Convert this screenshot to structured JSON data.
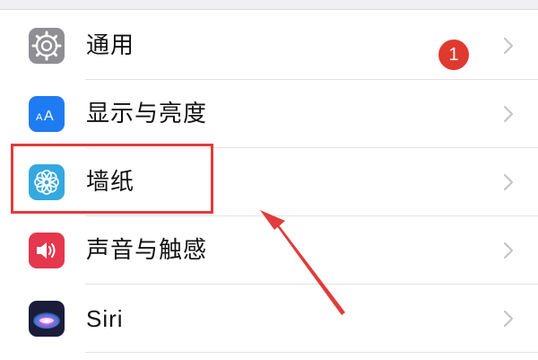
{
  "settings": {
    "rows": [
      {
        "label": "通用",
        "icon": "gear-icon",
        "badge": "1",
        "icon_color": "#8e8e93"
      },
      {
        "label": "显示与亮度",
        "icon": "display-brightness-icon",
        "icon_color": "#1f7bf2",
        "icon_text": "AA"
      },
      {
        "label": "墙纸",
        "icon": "wallpaper-flower-icon",
        "icon_color": "#35a8e0"
      },
      {
        "label": "声音与触感",
        "icon": "speaker-icon",
        "icon_color": "#e5374e"
      },
      {
        "label": "Siri",
        "icon": "siri-icon",
        "icon_color": "#1b1b3a"
      }
    ]
  },
  "annotation": {
    "highlight_color": "#e03c3c"
  }
}
